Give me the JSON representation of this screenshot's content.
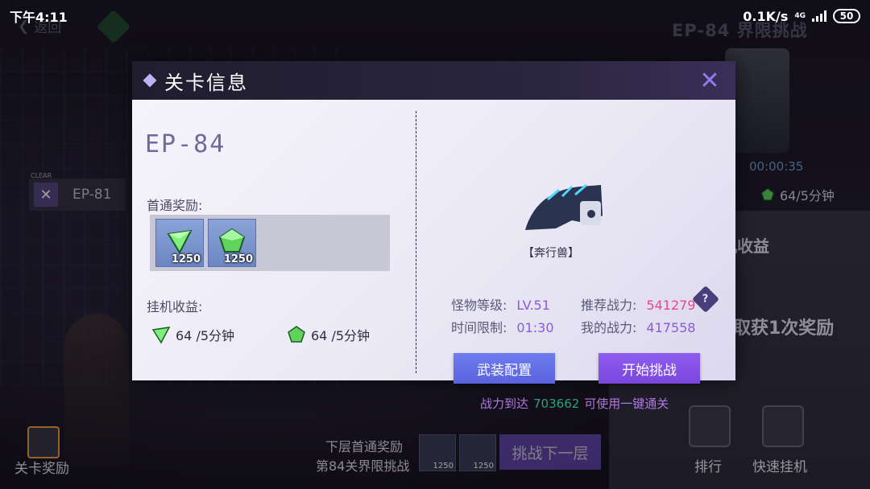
{
  "status_bar": {
    "time": "下午4:11",
    "network_speed": "0.1K/s",
    "network_type": "4G",
    "battery": "50"
  },
  "background": {
    "back_label": "返回",
    "stage_title": "EP-84 界限挑战",
    "timer": "00:00:35",
    "rate": "64/5分钟",
    "idle_title": "机收益",
    "reward_text": "取获1次奖励",
    "cleared_stage": "EP-81",
    "cleared_tag": "CLEAR",
    "stage_reward_label": "关卡奖励",
    "next_first_label": "下层首通奖励",
    "next_stage_label": "第84关界限挑战",
    "next_items": [
      "1250",
      "1250"
    ],
    "next_button": "挑战下一层",
    "rank_label": "排行",
    "quick_idle_label": "快速挂机"
  },
  "modal": {
    "title": "关卡信息",
    "stage_code": "EP-84",
    "first_reward_label": "首通奖励:",
    "first_rewards": [
      {
        "icon": "green-crystal-icon",
        "qty": "1250"
      },
      {
        "icon": "green-ore-icon",
        "qty": "1250"
      }
    ],
    "idle_label": "挂机收益:",
    "idle_items": [
      {
        "icon": "green-crystal-icon",
        "text": "64 /5分钟"
      },
      {
        "icon": "green-ore-icon",
        "text": "64 /5分钟"
      }
    ],
    "monster_name": "【奔行兽】",
    "monster_level_label": "怪物等级:",
    "monster_level": "LV.51",
    "time_limit_label": "时间限制:",
    "time_limit": "01:30",
    "recommended_power_label": "推荐战力:",
    "recommended_power": "541279",
    "my_power_label": "我的战力:",
    "my_power": "417558",
    "equip_button": "武装配置",
    "start_button": "开始挑战",
    "sweep_prefix": "战力到达",
    "sweep_power": "703662",
    "sweep_suffix": "可使用一键通关"
  },
  "colors": {
    "accent_purple": "#7a47dc",
    "accent_blue": "#5a63de",
    "recommended_power": "#e64a8c",
    "sweep_power": "#2aa37a"
  }
}
